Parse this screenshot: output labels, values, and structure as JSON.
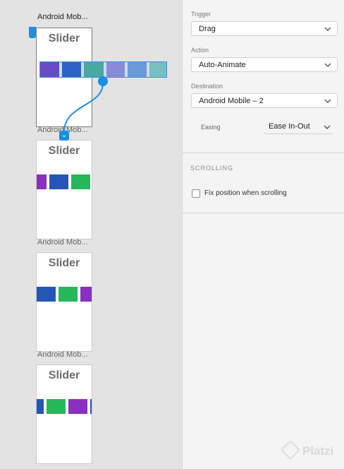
{
  "canvas": {
    "artboards": [
      {
        "title": "Android Mob...",
        "heading": "Slider"
      },
      {
        "title": "Android Mob...",
        "heading": "Slider"
      },
      {
        "title": "Android Mob...",
        "heading": "Slider"
      },
      {
        "title": "Android Mob...",
        "heading": "Slider"
      }
    ],
    "colors": {
      "purple": "#8a2fc0",
      "blue": "#2457b5",
      "green": "#26b85a",
      "violet": "#6a4bc6",
      "teal": "#76c0bd",
      "wire": "#1b8fe1"
    }
  },
  "panel": {
    "trigger": {
      "label": "Trigger",
      "value": "Drag"
    },
    "action": {
      "label": "Action",
      "value": "Auto-Animate"
    },
    "destination": {
      "label": "Destination",
      "value": "Android Mobile – 2"
    },
    "easing": {
      "label": "Easing",
      "value": "Ease In-Out"
    },
    "scrolling": {
      "title": "SCROLLING",
      "fix_position_label": "Fix position when scrolling",
      "fix_position_checked": false
    }
  },
  "watermark": {
    "text": "Platzi"
  }
}
